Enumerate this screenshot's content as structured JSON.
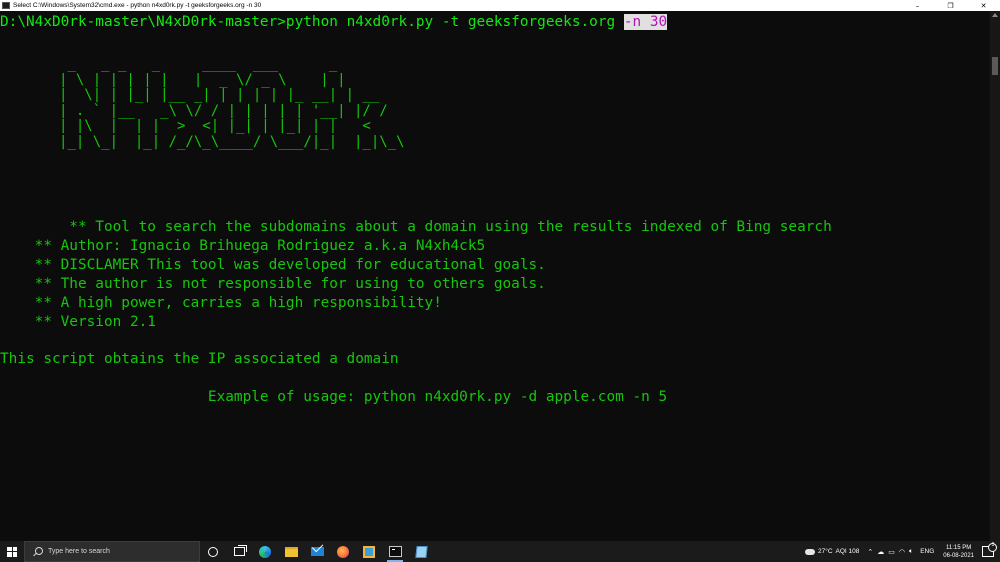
{
  "window": {
    "title": "Select C:\\Windows\\System32\\cmd.exe - python  n4xd0rk.py -t geeksforgeeks.org -n 30",
    "controls": {
      "minimize": "–",
      "maximize": "❐",
      "close": "✕"
    }
  },
  "console": {
    "prompt": "D:\\N4xD0rk-master\\N4xD0rk-master>",
    "command": "python n4xd0rk.py -t geeksforgeeks.org ",
    "command_highlight": "-n 30",
    "banner": "        _   _ _   _     ____  ___      _\n       | \\ | | | | |   |  _ \\/ _ \\    | |\n       |  \\| | |_| |__ _| | | | | |_ __| | __\n       | . ` |__   _\\ \\/ / | | | | | '__| |/ /\n       | |\\  |  | |  >  <| |_| | |_| | |   <\n       |_| \\_|  |_| /_/\\_\\____/ \\___/|_|  |_|\\_\\",
    "info_lines": [
      "        ** Tool to search the subdomains about a domain using the results indexed of Bing search",
      "    ** Author: Ignacio Brihuega Rodriguez a.k.a N4xh4ck5",
      "    ** DISCLAMER This tool was developed for educational goals.",
      "    ** The author is not responsible for using to others goals.",
      "    ** A high power, carries a high responsibility!",
      "    ** Version 2.1"
    ],
    "description": "This script obtains the IP associated a domain",
    "usage": "                        Example of usage: python n4xd0rk.py -d apple.com -n 5"
  },
  "taskbar": {
    "search_placeholder": "Type here to search",
    "weather_temp": "27°C",
    "weather_aqi": "AQI 108",
    "language": "ENG",
    "time": "11:15 PM",
    "date": "06-08-2021",
    "notification_count": "3"
  }
}
